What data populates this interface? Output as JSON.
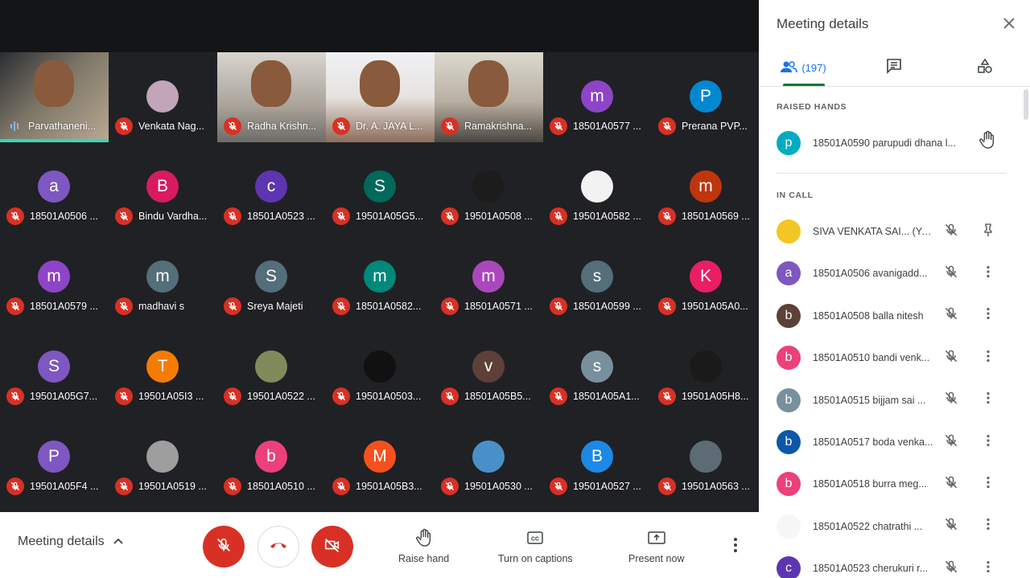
{
  "tiles": [
    {
      "name": "Parvathaneni...",
      "kind": "video",
      "style": "photo0",
      "speaking": true
    },
    {
      "name": "Venkata Nag...",
      "kind": "avatar-img",
      "color": "#c2a5b8"
    },
    {
      "name": "Radha Krishn...",
      "kind": "video",
      "style": "photo2"
    },
    {
      "name": "Dr. A. JAYA L...",
      "kind": "video",
      "style": "photo3"
    },
    {
      "name": "Ramakrishna...",
      "kind": "video",
      "style": "photo4"
    },
    {
      "name": "18501A0577 ...",
      "kind": "avatar",
      "letter": "m",
      "color": "#8e44c7"
    },
    {
      "name": "Prerana PVP...",
      "kind": "avatar",
      "letter": "P",
      "color": "#0288d1"
    },
    {
      "name": "18501A0506 ...",
      "kind": "avatar",
      "letter": "a",
      "color": "#7e57c2"
    },
    {
      "name": "Bindu Vardha...",
      "kind": "avatar",
      "letter": "B",
      "color": "#d81b60"
    },
    {
      "name": "18501A0523 ...",
      "kind": "avatar",
      "letter": "c",
      "color": "#5e35b1"
    },
    {
      "name": "19501A05G5...",
      "kind": "avatar",
      "letter": "S",
      "color": "#00695c"
    },
    {
      "name": "19501A0508 ...",
      "kind": "avatar-img",
      "color": "#1c1c1c"
    },
    {
      "name": "19501A0582 ...",
      "kind": "avatar-img",
      "color": "#f2f2f2"
    },
    {
      "name": "18501A0569 ...",
      "kind": "avatar",
      "letter": "m",
      "color": "#bf360c"
    },
    {
      "name": "18501A0579 ...",
      "kind": "avatar",
      "letter": "m",
      "color": "#8e44c7"
    },
    {
      "name": "madhavi s",
      "kind": "avatar",
      "letter": "m",
      "color": "#546e7a"
    },
    {
      "name": "Sreya Majeti",
      "kind": "avatar",
      "letter": "S",
      "color": "#546e7a"
    },
    {
      "name": "18501A0582...",
      "kind": "avatar",
      "letter": "m",
      "color": "#00897b"
    },
    {
      "name": "18501A0571 ...",
      "kind": "avatar",
      "letter": "m",
      "color": "#ab47bc"
    },
    {
      "name": "18501A0599 ...",
      "kind": "avatar",
      "letter": "s",
      "color": "#546e7a"
    },
    {
      "name": "19501A05A0...",
      "kind": "avatar",
      "letter": "K",
      "color": "#e91e63"
    },
    {
      "name": "19501A05G7...",
      "kind": "avatar",
      "letter": "S",
      "color": "#7e57c2"
    },
    {
      "name": "19501A05I3 ...",
      "kind": "avatar",
      "letter": "T",
      "color": "#f57c00"
    },
    {
      "name": "19501A0522 ...",
      "kind": "avatar-img",
      "color": "#7f8b5a"
    },
    {
      "name": "19501A0503...",
      "kind": "avatar-img",
      "color": "#111111"
    },
    {
      "name": "18501A05B5...",
      "kind": "avatar",
      "letter": "v",
      "color": "#5d4037"
    },
    {
      "name": "18501A05A1...",
      "kind": "avatar",
      "letter": "s",
      "color": "#78909c"
    },
    {
      "name": "19501A05H8...",
      "kind": "avatar-img",
      "color": "#1a1a1a"
    },
    {
      "name": "19501A05F4 ...",
      "kind": "avatar",
      "letter": "P",
      "color": "#7e57c2"
    },
    {
      "name": "19501A0519 ...",
      "kind": "avatar-img",
      "color": "#9e9e9e"
    },
    {
      "name": "18501A0510 ...",
      "kind": "avatar",
      "letter": "b",
      "color": "#ec407a"
    },
    {
      "name": "19501A05B3...",
      "kind": "avatar",
      "letter": "M",
      "color": "#f4511e"
    },
    {
      "name": "19501A0530 ...",
      "kind": "avatar-img",
      "color": "#4a90c8"
    },
    {
      "name": "19501A0527 ...",
      "kind": "avatar",
      "letter": "B",
      "color": "#1e88e5"
    },
    {
      "name": "19501A0563 ...",
      "kind": "avatar-img",
      "color": "#5d6b74"
    }
  ],
  "bottom_bar": {
    "meeting_details_label": "Meeting details",
    "raise_hand_label": "Raise hand",
    "captions_label": "Turn on captions",
    "present_label": "Present now"
  },
  "panel": {
    "title": "Meeting details",
    "people_count": "(197)",
    "raised_hands_label": "RAISED HANDS",
    "raised_hands": [
      {
        "name": "18501A0590 parupudi dhana l...",
        "letter": "p",
        "color": "#00acc1"
      }
    ],
    "in_call_label": "IN CALL",
    "in_call": [
      {
        "name": "SIVA VENKATA SAI... (You)",
        "letter": "",
        "color": "#f3c623",
        "img": true,
        "self": true
      },
      {
        "name": "18501A0506 avanigadd...",
        "letter": "a",
        "color": "#7e57c2"
      },
      {
        "name": "18501A0508 balla nitesh",
        "letter": "b",
        "color": "#5d4037"
      },
      {
        "name": "18501A0510 bandi venk...",
        "letter": "b",
        "color": "#ec407a"
      },
      {
        "name": "18501A0515 bijjam sai ...",
        "letter": "b",
        "color": "#78909c"
      },
      {
        "name": "18501A0517 boda venka...",
        "letter": "b",
        "color": "#0b57a8"
      },
      {
        "name": "18501A0518 burra meg...",
        "letter": "b",
        "color": "#ec407a"
      },
      {
        "name": "18501A0522 chatrathi ...",
        "letter": "",
        "color": "#f6f6f6",
        "img": true
      },
      {
        "name": "18501A0523 cherukuri r...",
        "letter": "c",
        "color": "#5e35b1"
      }
    ]
  }
}
